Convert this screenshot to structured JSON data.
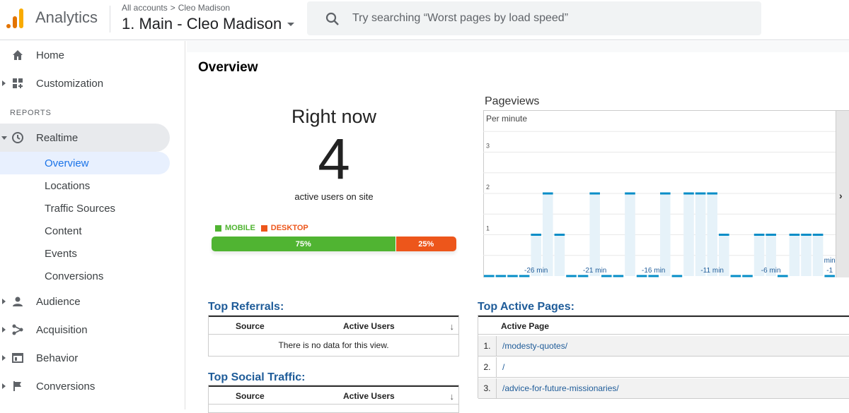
{
  "header": {
    "app_name": "Analytics",
    "breadcrumb_root": "All accounts",
    "breadcrumb_sep": ">",
    "breadcrumb_account": "Cleo Madison",
    "account_selector": "1. Main - Cleo Madison",
    "search_placeholder": "Try searching “Worst pages by load speed”"
  },
  "sidebar": {
    "top_items": [
      {
        "label": "Home",
        "icon": "home-icon"
      },
      {
        "label": "Customization",
        "icon": "customization-icon"
      }
    ],
    "reports_header": "REPORTS",
    "realtime": {
      "label": "Realtime",
      "icon": "clock-icon",
      "sub_items": [
        "Overview",
        "Locations",
        "Traffic Sources",
        "Content",
        "Events",
        "Conversions"
      ],
      "selected": "Overview"
    },
    "bottom_items": [
      {
        "label": "Audience",
        "icon": "person-icon"
      },
      {
        "label": "Acquisition",
        "icon": "acquisition-icon"
      },
      {
        "label": "Behavior",
        "icon": "behavior-icon"
      },
      {
        "label": "Conversions",
        "icon": "flag-icon"
      }
    ]
  },
  "main": {
    "title": "Overview",
    "right_now": {
      "title": "Right now",
      "count": "4",
      "subtitle": "active users on site",
      "legend": [
        {
          "label": "MOBILE",
          "color": "#50b432"
        },
        {
          "label": "DESKTOP",
          "color": "#ed561b"
        }
      ],
      "split": [
        {
          "label": "75%",
          "value": 75,
          "color": "#50b432"
        },
        {
          "label": "25%",
          "value": 25,
          "color": "#ed561b"
        }
      ]
    },
    "pageviews": {
      "title": "Pageviews",
      "per_minute_label": "Per minute"
    },
    "top_referrals": {
      "title": "Top Referrals:",
      "col_source": "Source",
      "col_users": "Active Users",
      "sort_icon": "↓",
      "empty_text": "There is no data for this view."
    },
    "top_social": {
      "title": "Top Social Traffic:",
      "col_source": "Source",
      "col_users": "Active Users",
      "sort_icon": "↓"
    },
    "top_active_pages": {
      "title": "Top Active Pages:",
      "col_page": "Active Page",
      "rows": [
        {
          "num": "1.",
          "path": "/modesty-quotes/"
        },
        {
          "num": "2.",
          "path": "/"
        },
        {
          "num": "3.",
          "path": "/advice-for-future-missionaries/"
        }
      ]
    }
  },
  "chart_data": {
    "type": "bar",
    "title": "Pageviews",
    "subtitle": "Per minute",
    "ylim": [
      0,
      4
    ],
    "y_ticks": [
      1,
      2,
      3
    ],
    "x_tick_labels": [
      "-26 min",
      "-21 min",
      "-16 min",
      "-11 min",
      "-6 min",
      "min -1"
    ],
    "x": [
      -30,
      -29,
      -28,
      -27,
      -26,
      -25,
      -24,
      -23,
      -22,
      -21,
      -20,
      -19,
      -18,
      -17,
      -16,
      -15,
      -14,
      -13,
      -12,
      -11,
      -10,
      -9,
      -8,
      -7,
      -6,
      -5,
      -4,
      -3,
      -2,
      -1
    ],
    "values": [
      0,
      0,
      0,
      0,
      1,
      2,
      1,
      0,
      0,
      2,
      0,
      0,
      2,
      0,
      0,
      2,
      0,
      2,
      2,
      2,
      1,
      0,
      0,
      1,
      1,
      0,
      1,
      1,
      1,
      0
    ],
    "color": "#058dc7",
    "fill": "#e6f2f9",
    "grid": true
  }
}
